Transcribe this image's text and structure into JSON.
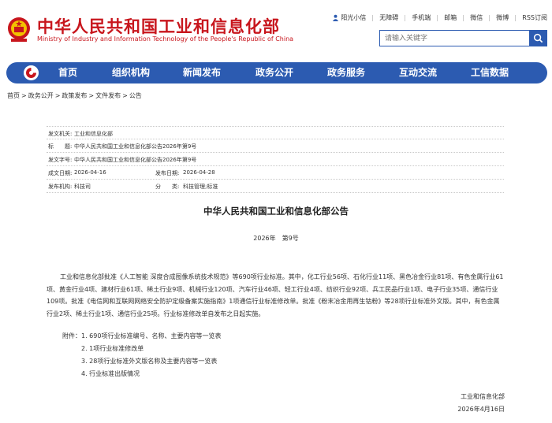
{
  "header": {
    "title": "中华人民共和国工业和信息化部",
    "subtitle": "Ministry of Industry and Information Technology of the People's Republic of China",
    "top_links": [
      "阳光小信",
      "无障碍",
      "手机端",
      "邮箱",
      "微信",
      "微博",
      "RSS订阅"
    ],
    "search_placeholder": "请输入关键字"
  },
  "nav": {
    "items": [
      "首页",
      "组织机构",
      "新闻发布",
      "政务公开",
      "政务服务",
      "互动交流",
      "工信数据"
    ]
  },
  "breadcrumb": [
    "首页",
    "政务公开",
    "政策发布",
    "文件发布",
    "公告"
  ],
  "meta": {
    "issuer_label": "发文机关:",
    "issuer": "工业和信息化部",
    "title_label": "标　　题:",
    "title": "中华人民共和国工业和信息化部公告2026年第9号",
    "docno_label": "发文字号:",
    "docno": "中华人民共和国工业和信息化部公告2026年第9号",
    "created_label": "成文日期:",
    "created": "2026-04-16",
    "published_label": "发布日期:",
    "published": "2026-04-28",
    "org_label": "发布机构:",
    "org": "科技司",
    "category_label": "分　　类:",
    "category": "科技管理;标准"
  },
  "document": {
    "title": "中华人民共和国工业和信息化部公告",
    "number": "2026年　第9号",
    "body": "工业和信息化部批准《人工智能 深度合成图像系统技术规范》等690项行业标准。其中，化工行业56项、石化行业11项、黑色冶金行业81项、有色金属行业61项、黄金行业4项、建材行业61项、稀土行业9项、机械行业120项、汽车行业46项、轻工行业4项、纺织行业92项、兵工民品行业1项、电子行业35项、通信行业109项。批准《电信网和互联网网络安全防护定级备案实施指南》1项通信行业标准修改单。批准《粉末冶金用再生钴粉》等28项行业标准外文版。其中，有色金属行业2项、稀土行业1项、通信行业25项。行业标准修改单自发布之日起实施。",
    "attachments_label": "附件：",
    "attachments": [
      "1. 690项行业标准编号、名称、主要内容等一览表",
      "2. 1项行业标准修改单",
      "3. 28项行业标准外文版名称及主要内容等一览表",
      "4. 行业标准出版情况"
    ],
    "sign_org": "工业和信息化部",
    "sign_date": "2026年4月16日"
  },
  "colors": {
    "brand_red": "#c8161d",
    "nav_blue": "#2c5bb1"
  }
}
